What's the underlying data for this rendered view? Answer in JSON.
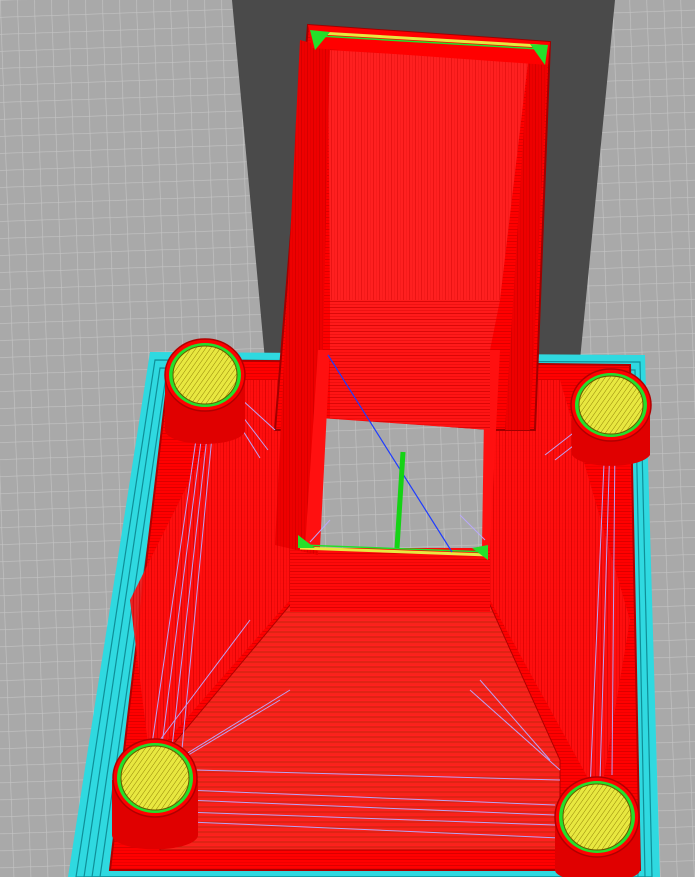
{
  "viewer": {
    "mode": "layer-preview",
    "colors": {
      "background": "#a9a9a9",
      "grid_line": "#c4c4c4",
      "shadow": "#4a4a4a",
      "outer_wall": "#ff0000",
      "wall_lines": "#c80000",
      "infill": "#ff1a1a",
      "skirt": "#2fd9e0",
      "skirt_lines": "#0f8f98",
      "top_skin": "#e8e840",
      "inner_wall": "#24e02a",
      "support_tip": "#1e3cff",
      "travel_move": "#b9a8ff",
      "nozzle_marker": "#15d315"
    },
    "icons": {
      "nozzle": "nozzle-position-icon"
    }
  }
}
